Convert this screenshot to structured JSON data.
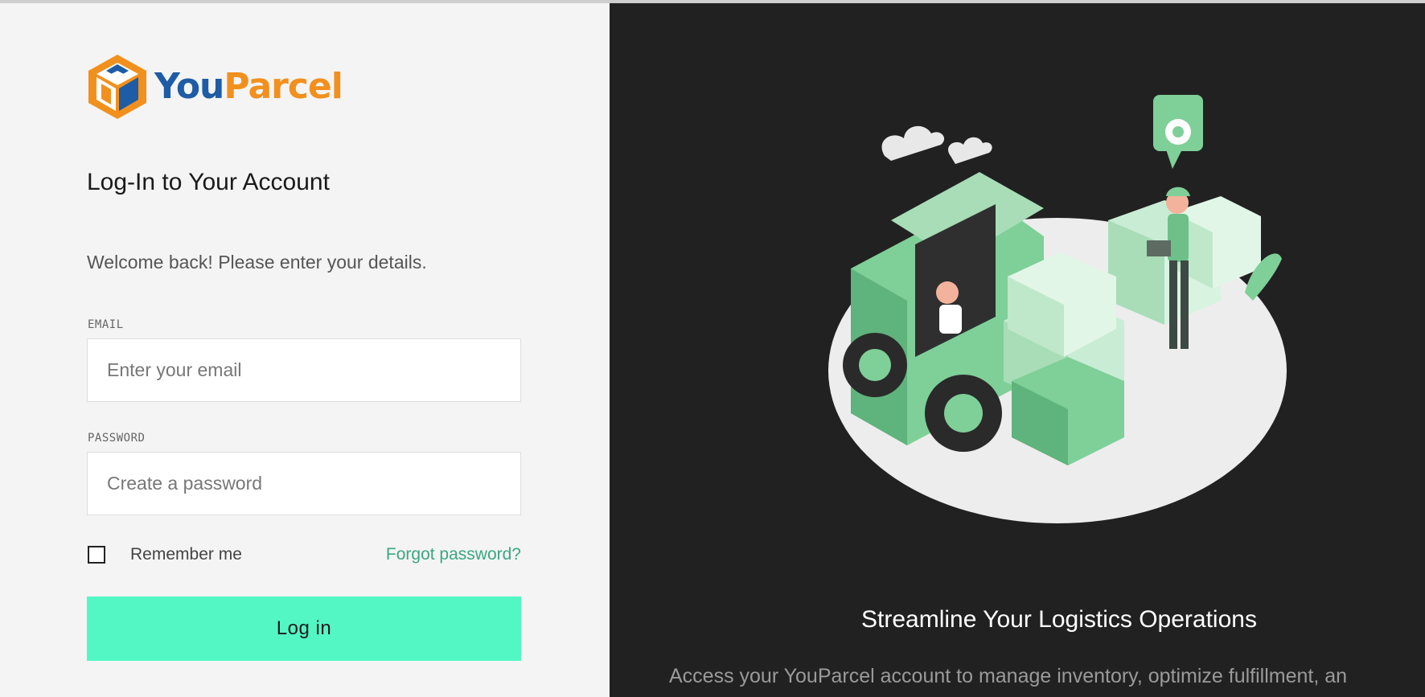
{
  "brand": {
    "name_part1": "You",
    "name_part2": "Parcel",
    "colors": {
      "blue": "#1e5ca6",
      "orange": "#f2901e"
    }
  },
  "login": {
    "title": "Log-In to Your Account",
    "subtitle": "Welcome back! Please enter your details.",
    "email_label": "EMAIL",
    "email_placeholder": "Enter your email",
    "password_label": "PASSWORD",
    "password_placeholder": "Create a password",
    "remember_label": "Remember me",
    "remember_checked": false,
    "forgot_label": "Forgot password?",
    "submit_label": "Log in",
    "accent_color": "#52f7c4",
    "link_color": "#3aa781"
  },
  "promo": {
    "illustration_icon": "logistics-forklift-illustration",
    "title": "Streamline Your Logistics Operations",
    "text": "Access your YouParcel account to manage inventory, optimize fulfillment, an",
    "background_color": "#212121"
  }
}
